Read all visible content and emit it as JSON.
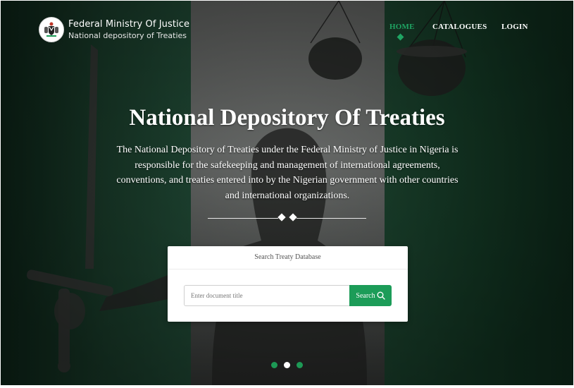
{
  "header": {
    "brand_title": "Federal Ministry Of Justice",
    "brand_subtitle": "National depository of Treaties",
    "logo_icon": "coat-of-arms-icon"
  },
  "nav": {
    "items": [
      {
        "label": "HOME",
        "active": true
      },
      {
        "label": "CATALOGUES",
        "active": false
      },
      {
        "label": "LOGIN",
        "active": false
      }
    ]
  },
  "hero": {
    "title": "National Depository Of Treaties",
    "description": "The National Depository of Treaties under the Federal Ministry of Justice in Nigeria is responsible for the safekeeping and management of international agreements, conventions, and treaties entered into by the Nigerian government with other countries and international organizations."
  },
  "search": {
    "heading": "Search Treaty Database",
    "placeholder": "Enter document title",
    "value": "",
    "button_label": "Search",
    "button_icon": "search-icon"
  },
  "carousel": {
    "slide_count": 3,
    "active_index": 1
  },
  "colors": {
    "accent": "#1c9c58",
    "nav_active": "#1fa463",
    "white": "#ffffff"
  }
}
